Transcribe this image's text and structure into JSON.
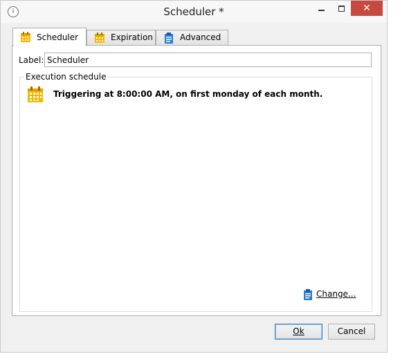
{
  "window": {
    "title": "Scheduler *",
    "app_icon": "info-icon"
  },
  "tabs": [
    {
      "label": "Scheduler",
      "icon": "calendar-icon",
      "active": true
    },
    {
      "label": "Expiration",
      "icon": "calendar-icon",
      "active": false
    },
    {
      "label": "Advanced",
      "icon": "clipboard-icon",
      "active": false
    }
  ],
  "form": {
    "label_caption": "Label:",
    "label_value": "Scheduler"
  },
  "schedule": {
    "legend": "Execution schedule",
    "summary": "Triggering at 8:00:00 AM, on first monday of each month.",
    "change_link": "Change..."
  },
  "buttons": {
    "ok": "Ok",
    "cancel": "Cancel"
  },
  "colors": {
    "calendar_icon": "#f5b800",
    "clipboard_icon": "#2b7bd1",
    "close_button": "#c74a41"
  }
}
